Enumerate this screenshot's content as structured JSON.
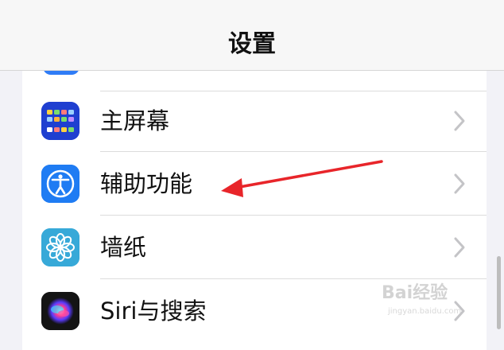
{
  "header": {
    "title": "设置"
  },
  "rows": [
    {
      "label": "主屏幕",
      "icon": "home-screen-icon",
      "color": "#2b4bd9"
    },
    {
      "label": "辅助功能",
      "icon": "accessibility-icon",
      "color": "#1f7cf3"
    },
    {
      "label": "墙纸",
      "icon": "wallpaper-flower-icon",
      "color": "#37a9d8"
    },
    {
      "label": "Siri与搜索",
      "icon": "siri-icon",
      "color": "#1a1a1a"
    }
  ],
  "colors": {
    "background": "#f2f2f7",
    "annotation_arrow": "#e8252a",
    "separator": "#dcdcdc"
  },
  "watermark": {
    "text": "Bai经验",
    "url": "jingyan.baidu.com"
  }
}
